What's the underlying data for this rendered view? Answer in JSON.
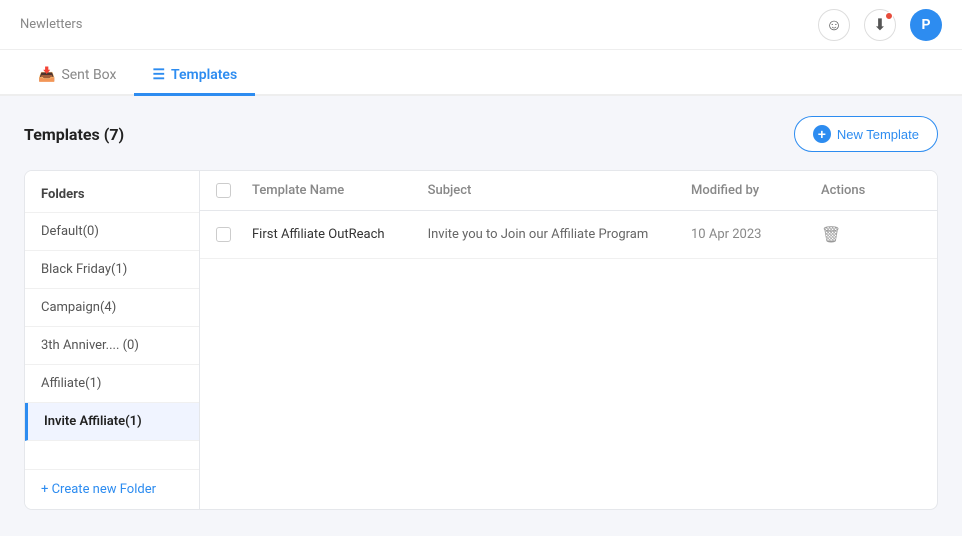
{
  "topbar": {
    "app_name": "Newletters",
    "avatar_label": "P"
  },
  "tabs": [
    {
      "id": "sentbox",
      "label": "Sent Box",
      "icon": "📥",
      "active": false
    },
    {
      "id": "templates",
      "label": "Templates",
      "icon": "≡",
      "active": true
    }
  ],
  "page": {
    "title": "Templates (7)",
    "new_template_btn": "New Template"
  },
  "sidebar": {
    "header": "Folders",
    "folders": [
      {
        "id": "default",
        "label": "Default(0)",
        "active": false
      },
      {
        "id": "blackfriday",
        "label": "Black Friday(1)",
        "active": false
      },
      {
        "id": "campaign",
        "label": "Campaign(4)",
        "active": false
      },
      {
        "id": "anniver",
        "label": "3th Anniver.... (0)",
        "active": false
      },
      {
        "id": "affiliate",
        "label": "Affiliate(1)",
        "active": false
      },
      {
        "id": "invite",
        "label": "Invite Affiliate(1)",
        "active": true
      }
    ],
    "create_folder_label": "+ Create new Folder"
  },
  "table": {
    "headers": [
      {
        "id": "checkbox",
        "label": ""
      },
      {
        "id": "template_name",
        "label": "Template Name"
      },
      {
        "id": "subject",
        "label": "Subject"
      },
      {
        "id": "modified_by",
        "label": "Modified by"
      },
      {
        "id": "actions",
        "label": "Actions"
      }
    ],
    "rows": [
      {
        "id": "row1",
        "template_name": "First Affiliate OutReach",
        "subject": "Invite you to Join our Affiliate Program",
        "modified_by": "10 Apr 2023"
      }
    ]
  }
}
